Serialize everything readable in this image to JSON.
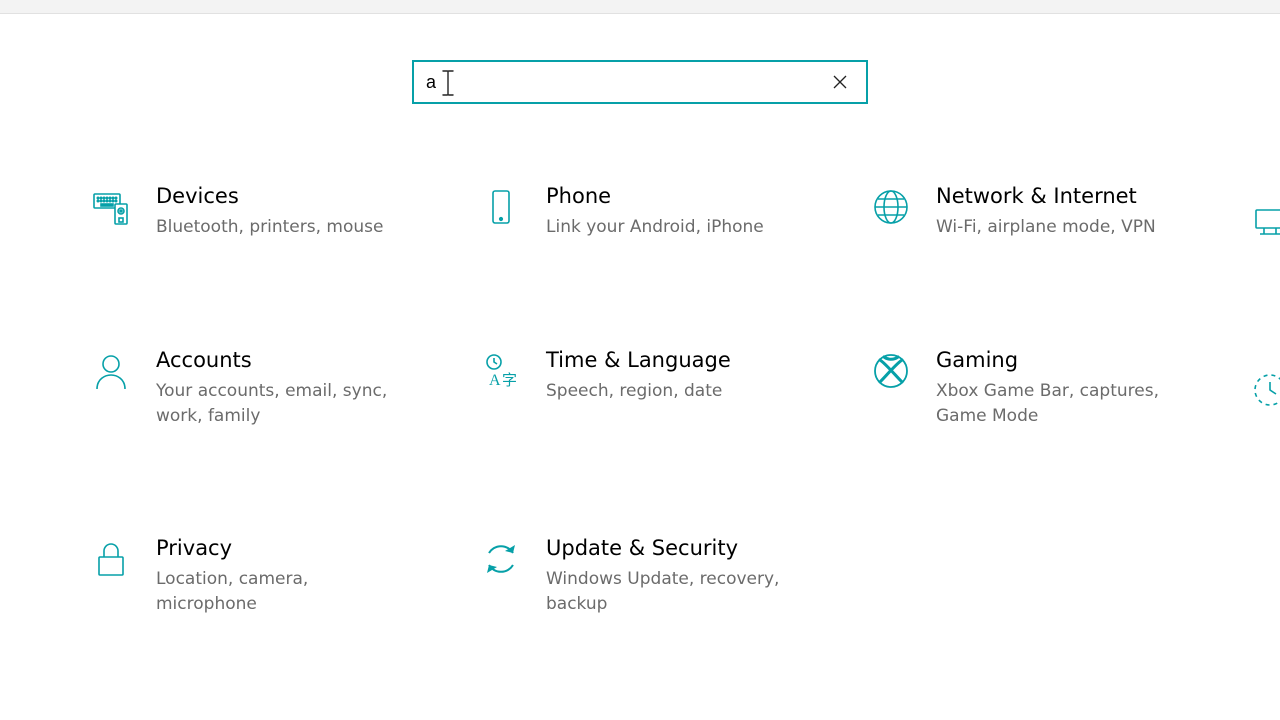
{
  "accent": "#06a0a8",
  "search": {
    "value": "a",
    "placeholder": ""
  },
  "tiles": [
    {
      "title": "Devices",
      "desc": "Bluetooth, printers, mouse"
    },
    {
      "title": "Phone",
      "desc": "Link your Android, iPhone"
    },
    {
      "title": "Network & Internet",
      "desc": "Wi-Fi, airplane mode, VPN"
    },
    {
      "title": "Accounts",
      "desc": "Your accounts, email, sync, work, family"
    },
    {
      "title": "Time & Language",
      "desc": "Speech, region, date"
    },
    {
      "title": "Gaming",
      "desc": "Xbox Game Bar, captures, Game Mode"
    },
    {
      "title": "Privacy",
      "desc": "Location, camera, microphone"
    },
    {
      "title": "Update & Security",
      "desc": "Windows Update, recovery, backup"
    }
  ]
}
